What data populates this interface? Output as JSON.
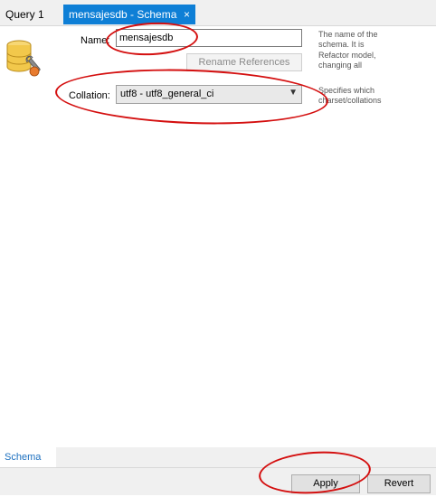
{
  "tabs": [
    {
      "label": "Query 1"
    },
    {
      "label": "mensajesdb - Schema",
      "active": true,
      "close": "×"
    }
  ],
  "schema": {
    "name_label": "Name:",
    "name_value": "mensajesdb",
    "rename_label": "Rename References",
    "collation_label": "Collation:",
    "collation_value": "utf8 - utf8_general_ci",
    "hints": {
      "name_line1": "The name of the",
      "name_line2": "schema. It is",
      "refactor_line1": "Refactor model,",
      "refactor_line2": "changing all",
      "collation_line1": "Specifies which",
      "collation_line2": "charset/collations"
    }
  },
  "bottom_tabs": [
    {
      "label": "Schema"
    }
  ],
  "footer": {
    "apply_label": "Apply",
    "revert_label": "Revert"
  },
  "colors": {
    "active_tab": "#0e7fd6",
    "annotation": "#d40f0f",
    "link": "#1c6fbf"
  },
  "icons": {
    "schema_icon": "database-wrench-icon",
    "close_icon": "close-icon",
    "dropdown_icon": "chevron-down-icon"
  }
}
